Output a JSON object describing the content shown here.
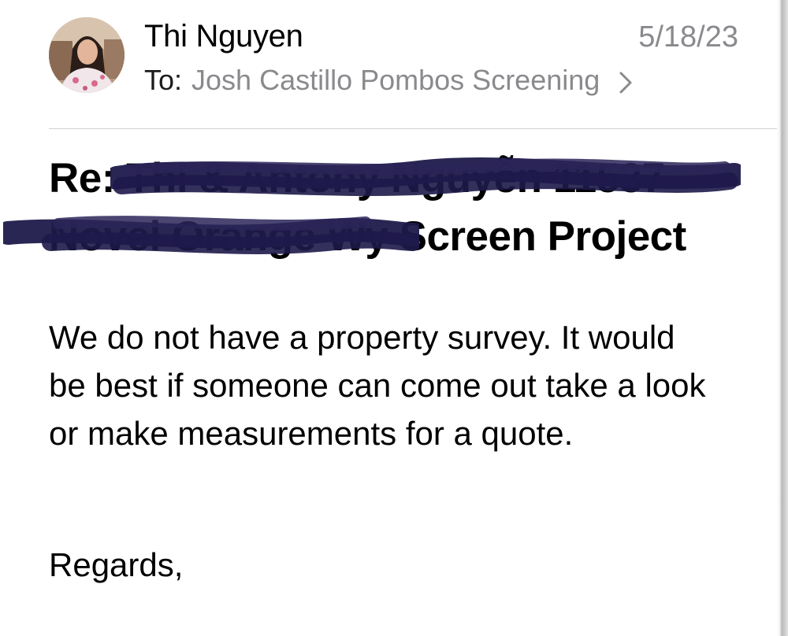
{
  "message": {
    "sender_name": "Thi Nguyen",
    "date": "5/18/23",
    "to_label": "To:",
    "recipients": "Josh Castillo Pombos Screening",
    "subject": {
      "prefix": "Re:",
      "line1_redacted": "Thi & Antony Nguyễn 11537",
      "line2_redacted": "Novel Orange Wy",
      "line2_visible": "Screen Project"
    },
    "body_lines": [
      "We do not have a property survey. It would",
      "be best if someone can come out take a look",
      "or make measurements for a quote."
    ],
    "closing": "Regards,"
  },
  "icons": {
    "recipients_disclosure": "chevron-right-icon",
    "sender_avatar": "avatar-photo"
  },
  "colors": {
    "secondary_text": "#8a8a8e",
    "redaction_ink": "#1e1a4a"
  }
}
